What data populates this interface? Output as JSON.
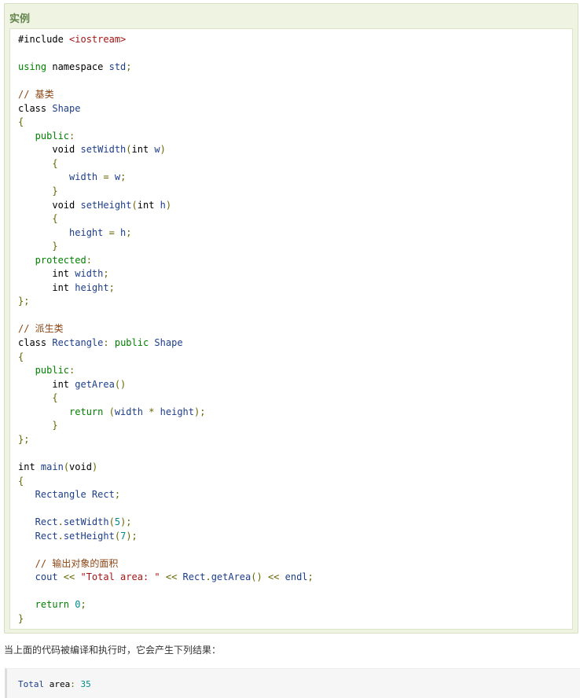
{
  "example": {
    "title": "实例",
    "code_lines": [
      [
        {
          "t": "#include ",
          "c": "plain"
        },
        {
          "t": "<iostream>",
          "c": "str"
        }
      ],
      [],
      [
        {
          "t": "using",
          "c": "kw2"
        },
        {
          "t": " namespace ",
          "c": "plain"
        },
        {
          "t": "std",
          "c": "id"
        },
        {
          "t": ";",
          "c": "pn"
        }
      ],
      [],
      [
        {
          "t": "// 基类",
          "c": "cm"
        }
      ],
      [
        {
          "t": "class ",
          "c": "kw"
        },
        {
          "t": "Shape",
          "c": "id"
        }
      ],
      [
        {
          "t": "{",
          "c": "pn"
        }
      ],
      [
        {
          "t": "   public",
          "c": "kw2"
        },
        {
          "t": ":",
          "c": "pn"
        }
      ],
      [
        {
          "t": "      void ",
          "c": "kw"
        },
        {
          "t": "setWidth",
          "c": "id"
        },
        {
          "t": "(",
          "c": "pn"
        },
        {
          "t": "int ",
          "c": "kw"
        },
        {
          "t": "w",
          "c": "id"
        },
        {
          "t": ")",
          "c": "pn"
        }
      ],
      [
        {
          "t": "      {",
          "c": "pn"
        }
      ],
      [
        {
          "t": "         width ",
          "c": "id"
        },
        {
          "t": "= ",
          "c": "pn"
        },
        {
          "t": "w",
          "c": "id"
        },
        {
          "t": ";",
          "c": "pn"
        }
      ],
      [
        {
          "t": "      }",
          "c": "pn"
        }
      ],
      [
        {
          "t": "      void ",
          "c": "kw"
        },
        {
          "t": "setHeight",
          "c": "id"
        },
        {
          "t": "(",
          "c": "pn"
        },
        {
          "t": "int ",
          "c": "kw"
        },
        {
          "t": "h",
          "c": "id"
        },
        {
          "t": ")",
          "c": "pn"
        }
      ],
      [
        {
          "t": "      {",
          "c": "pn"
        }
      ],
      [
        {
          "t": "         height ",
          "c": "id"
        },
        {
          "t": "= ",
          "c": "pn"
        },
        {
          "t": "h",
          "c": "id"
        },
        {
          "t": ";",
          "c": "pn"
        }
      ],
      [
        {
          "t": "      }",
          "c": "pn"
        }
      ],
      [
        {
          "t": "   protected",
          "c": "kw2"
        },
        {
          "t": ":",
          "c": "pn"
        }
      ],
      [
        {
          "t": "      int ",
          "c": "kw"
        },
        {
          "t": "width",
          "c": "id"
        },
        {
          "t": ";",
          "c": "pn"
        }
      ],
      [
        {
          "t": "      int ",
          "c": "kw"
        },
        {
          "t": "height",
          "c": "id"
        },
        {
          "t": ";",
          "c": "pn"
        }
      ],
      [
        {
          "t": "};",
          "c": "pn"
        }
      ],
      [],
      [
        {
          "t": "// 派生类",
          "c": "cm"
        }
      ],
      [
        {
          "t": "class ",
          "c": "kw"
        },
        {
          "t": "Rectangle",
          "c": "id"
        },
        {
          "t": ": ",
          "c": "pn"
        },
        {
          "t": "public ",
          "c": "kw2"
        },
        {
          "t": "Shape",
          "c": "id"
        }
      ],
      [
        {
          "t": "{",
          "c": "pn"
        }
      ],
      [
        {
          "t": "   public",
          "c": "kw2"
        },
        {
          "t": ":",
          "c": "pn"
        }
      ],
      [
        {
          "t": "      int ",
          "c": "kw"
        },
        {
          "t": "getArea",
          "c": "id"
        },
        {
          "t": "()",
          "c": "pn"
        }
      ],
      [
        {
          "t": "      {",
          "c": "pn"
        }
      ],
      [
        {
          "t": "         return ",
          "c": "kw2"
        },
        {
          "t": "(",
          "c": "pn"
        },
        {
          "t": "width ",
          "c": "id"
        },
        {
          "t": "* ",
          "c": "pn"
        },
        {
          "t": "height",
          "c": "id"
        },
        {
          "t": ");",
          "c": "pn"
        }
      ],
      [
        {
          "t": "      }",
          "c": "pn"
        }
      ],
      [
        {
          "t": "};",
          "c": "pn"
        }
      ],
      [],
      [
        {
          "t": "int ",
          "c": "kw"
        },
        {
          "t": "main",
          "c": "id"
        },
        {
          "t": "(",
          "c": "pn"
        },
        {
          "t": "void",
          "c": "kw"
        },
        {
          "t": ")",
          "c": "pn"
        }
      ],
      [
        {
          "t": "{",
          "c": "pn"
        }
      ],
      [
        {
          "t": "   Rectangle ",
          "c": "id"
        },
        {
          "t": "Rect",
          "c": "id"
        },
        {
          "t": ";",
          "c": "pn"
        }
      ],
      [],
      [
        {
          "t": "   Rect",
          "c": "id"
        },
        {
          "t": ".",
          "c": "pn"
        },
        {
          "t": "setWidth",
          "c": "id"
        },
        {
          "t": "(",
          "c": "pn"
        },
        {
          "t": "5",
          "c": "num"
        },
        {
          "t": ");",
          "c": "pn"
        }
      ],
      [
        {
          "t": "   Rect",
          "c": "id"
        },
        {
          "t": ".",
          "c": "pn"
        },
        {
          "t": "setHeight",
          "c": "id"
        },
        {
          "t": "(",
          "c": "pn"
        },
        {
          "t": "7",
          "c": "num"
        },
        {
          "t": ");",
          "c": "pn"
        }
      ],
      [],
      [
        {
          "t": "   // 输出对象的面积",
          "c": "cm"
        }
      ],
      [
        {
          "t": "   cout ",
          "c": "id"
        },
        {
          "t": "<< ",
          "c": "pn"
        },
        {
          "t": "\"Total area: \"",
          "c": "str"
        },
        {
          "t": " << ",
          "c": "pn"
        },
        {
          "t": "Rect",
          "c": "id"
        },
        {
          "t": ".",
          "c": "pn"
        },
        {
          "t": "getArea",
          "c": "id"
        },
        {
          "t": "() << ",
          "c": "pn"
        },
        {
          "t": "endl",
          "c": "id"
        },
        {
          "t": ";",
          "c": "pn"
        }
      ],
      [],
      [
        {
          "t": "   return ",
          "c": "kw2"
        },
        {
          "t": "0",
          "c": "num"
        },
        {
          "t": ";",
          "c": "pn"
        }
      ],
      [
        {
          "t": "}",
          "c": "pn"
        }
      ]
    ]
  },
  "description": "当上面的代码被编译和执行时，它会产生下列结果：",
  "output": {
    "tokens": [
      {
        "t": "Total ",
        "c": "id"
      },
      {
        "t": "area",
        "c": "plain"
      },
      {
        "t": ": ",
        "c": "pn"
      },
      {
        "t": "35",
        "c": "num"
      }
    ]
  },
  "colors": {
    "example_bg": "#eef3e2",
    "example_border": "#d6dfc1",
    "title": "#64854c",
    "keyword_green": "#008000",
    "identifier_blue": "#1d3e8a",
    "string_red": "#a31515",
    "comment_brown": "#8b4513",
    "number_teal": "#008a8a"
  }
}
